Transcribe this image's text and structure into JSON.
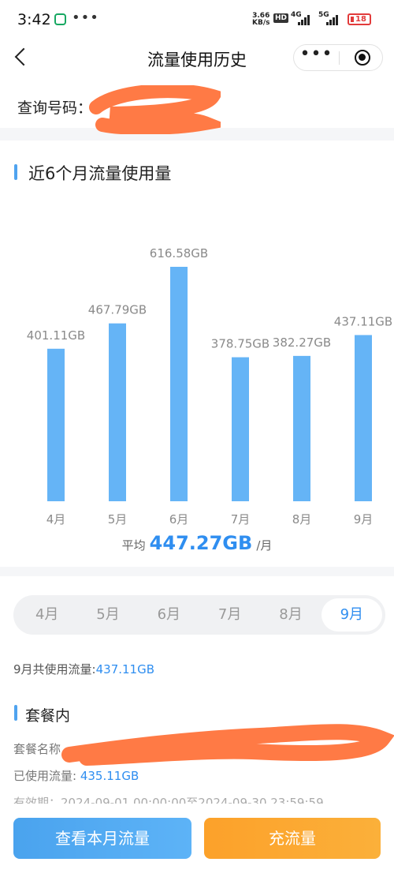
{
  "status_bar": {
    "time": "3:42",
    "dots": "•••",
    "speed_value": "3.66",
    "speed_unit": "KB/s",
    "hd_label": "HD",
    "net_4g": "4G",
    "net_5g": "5G",
    "battery": "18",
    "battery_color": "#e23b3b"
  },
  "nav": {
    "title": "流量使用历史",
    "more_glyph": "•••"
  },
  "query": {
    "label": "查询号码：",
    "value_visible": "1"
  },
  "chart_section": {
    "title": "近6个月流量使用量",
    "accent_color": "#4fa3ef",
    "bar_color": "#65b4f6"
  },
  "chart_data": {
    "type": "bar",
    "categories": [
      "4月",
      "5月",
      "6月",
      "7月",
      "8月",
      "9月"
    ],
    "values": [
      401.11,
      467.79,
      616.58,
      378.75,
      382.27,
      437.11
    ],
    "data_labels": [
      "401.11GB",
      "467.79GB",
      "616.58GB",
      "378.75GB",
      "382.27GB",
      "437.11GB"
    ],
    "unit": "GB",
    "title": "近6个月流量使用量",
    "xlabel": "",
    "ylabel": "",
    "ylim": [
      0,
      616.58
    ],
    "grid": false,
    "legend": "none"
  },
  "average": {
    "prefix": "平均",
    "value": "447.27GB",
    "suffix": "/月",
    "color": "#2f8ef0"
  },
  "tabs": {
    "items": [
      "4月",
      "5月",
      "6月",
      "7月",
      "8月",
      "9月"
    ],
    "selected": "9月"
  },
  "month_total": {
    "label": "9月共使用流量:",
    "value": "437.11GB"
  },
  "package": {
    "title": "套餐内",
    "name_label": "套餐名称",
    "used_label": "已使用流量:",
    "used_value": "435.11GB",
    "validity_text": "有效期：2024-09-01 00:00:00至2024-09-30 23:59:59"
  },
  "actions": {
    "view_label": "查看本月流量",
    "recharge_label": "充流量",
    "view_color": "#4aa3ee",
    "recharge_color": "#fca12a"
  }
}
